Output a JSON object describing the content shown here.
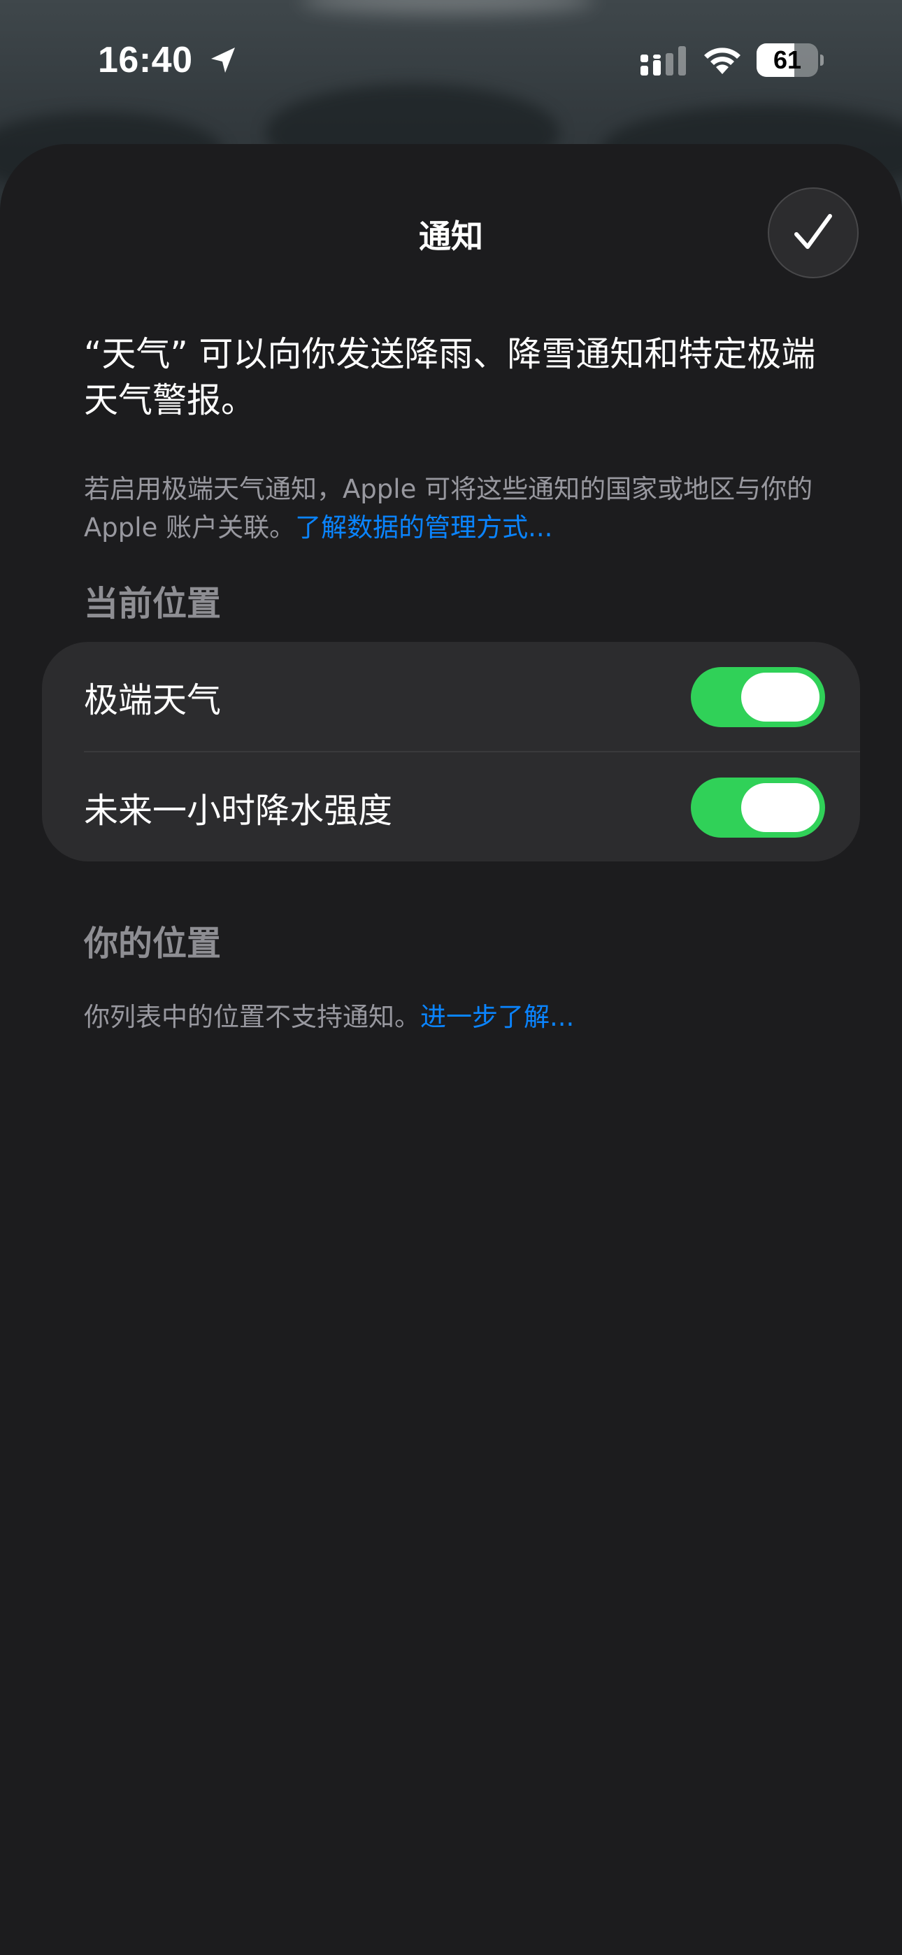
{
  "status_bar": {
    "time": "16:40",
    "battery_level": 61,
    "battery_text": "61",
    "icons": [
      "location-arrow-icon",
      "cellular-signal-icon",
      "wifi-icon",
      "battery-icon"
    ]
  },
  "sheet": {
    "title": "通知",
    "done_icon": "checkmark-icon",
    "intro": "“天气” 可以向你发送降雨、降雪通知和特定极端天气警报。",
    "footnote_text": "若启用极端天气通知，Apple 可将这些通知的国家或地区与你的 Apple 账户关联。",
    "footnote_link": "了解数据的管理方式..."
  },
  "current_location": {
    "header": "当前位置",
    "rows": [
      {
        "label": "极端天气",
        "enabled": true
      },
      {
        "label": "未来一小时降水强度",
        "enabled": true
      }
    ]
  },
  "your_locations": {
    "header": "你的位置",
    "note_text": "你列表中的位置不支持通知。",
    "note_link": "进一步了解..."
  },
  "colors": {
    "background": "#1c1c1e",
    "group_background": "#2c2c2e",
    "toggle_on": "#30d158",
    "link": "#0a84ff",
    "secondary_text": "#98989f",
    "section_header": "#8e8e93"
  }
}
